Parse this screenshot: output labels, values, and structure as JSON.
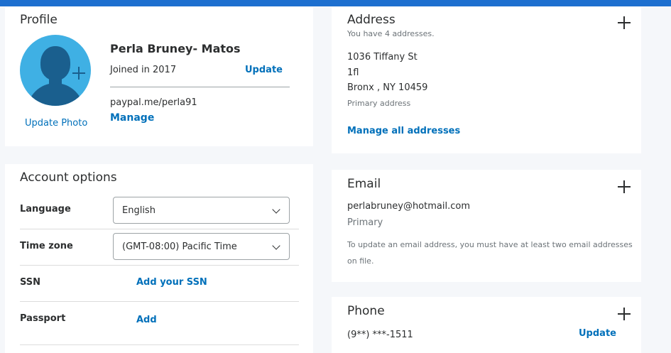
{
  "profile": {
    "title": "Profile",
    "name": "Perla Bruney- Matos",
    "joined": "Joined in 2017",
    "update_label": "Update",
    "update_photo_label": "Update Photo",
    "paypalme": "paypal.me/perla91",
    "manage_label": "Manage",
    "avatar_icon": "person-silhouette-icon",
    "avatar_color": "#3fb0e4"
  },
  "account": {
    "title": "Account options",
    "language_label": "Language",
    "language_value": "English",
    "timezone_label": "Time zone",
    "timezone_value": "(GMT-08:00) Pacific Time",
    "ssn_label": "SSN",
    "ssn_action": "Add your SSN",
    "passport_label": "Passport",
    "passport_action": "Add"
  },
  "address": {
    "title": "Address",
    "count_text": "You have 4 addresses.",
    "line1": "1036 Tiffany St",
    "line2": "1fl",
    "line3": "Bronx , NY 10459",
    "primary_label": "Primary address",
    "manage_all_label": "Manage all addresses"
  },
  "email": {
    "title": "Email",
    "value": "perlabruney@hotmail.com",
    "primary_label": "Primary",
    "note_line1": "To update an email address, you must have at least two email addresses",
    "note_line2": "on file."
  },
  "phone": {
    "title": "Phone",
    "value": "(9**) ***-1511",
    "update_label": "Update"
  },
  "colors": {
    "link": "#0070ba",
    "topbar": "#1d6fcf",
    "background": "#f5f7fa"
  }
}
